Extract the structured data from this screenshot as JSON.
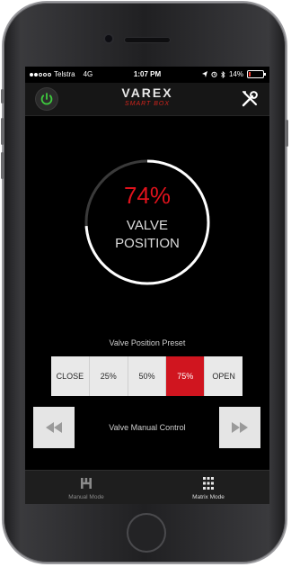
{
  "status_bar": {
    "carrier": "Telstra",
    "network": "4G",
    "time": "1:07 PM",
    "battery": "14%",
    "battery_level": 0.14,
    "signal_bars": 2
  },
  "header": {
    "brand": "VAREX",
    "sub_brand": "SMART BOX",
    "power_icon": "power-icon",
    "settings_icon": "tools-icon"
  },
  "gauge": {
    "value": "74%",
    "fraction": 0.74,
    "label_line1": "VALVE",
    "label_line2": "POSITION"
  },
  "preset": {
    "title": "Valve Position Preset",
    "options": [
      "CLOSE",
      "25%",
      "50%",
      "75%",
      "OPEN"
    ],
    "selected": "75%"
  },
  "manual": {
    "title": "Valve Manual Control",
    "left_icon": "rewind-icon",
    "right_icon": "fast-forward-icon"
  },
  "tabs": [
    {
      "label": "Manual Mode",
      "icon": "manual-mode-icon"
    },
    {
      "label": "Matrix Mode",
      "icon": "grid-icon"
    }
  ],
  "colors": {
    "accent": "#d0151f",
    "power": "#3ecb3e",
    "background": "#000000"
  }
}
